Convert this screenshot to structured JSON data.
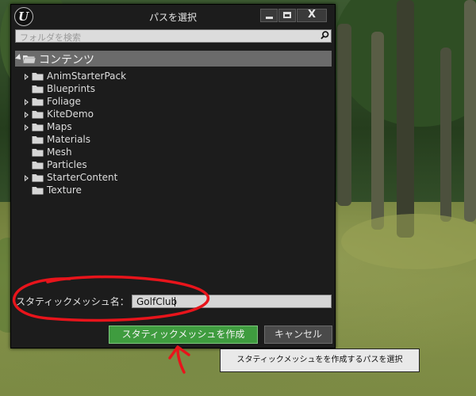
{
  "window": {
    "title": "パスを選択",
    "logo_text": "U",
    "minimize_label": "",
    "close_label": "X"
  },
  "search": {
    "placeholder": "フォルダを検索"
  },
  "tree": {
    "root_label": "コンテンツ",
    "items": [
      {
        "label": "AnimStarterPack",
        "expandable": true
      },
      {
        "label": "Blueprints",
        "expandable": false
      },
      {
        "label": "Foliage",
        "expandable": true
      },
      {
        "label": "KiteDemo",
        "expandable": true
      },
      {
        "label": "Maps",
        "expandable": true
      },
      {
        "label": "Materials",
        "expandable": false
      },
      {
        "label": "Mesh",
        "expandable": false
      },
      {
        "label": "Particles",
        "expandable": false
      },
      {
        "label": "StarterContent",
        "expandable": true
      },
      {
        "label": "Texture",
        "expandable": false
      }
    ]
  },
  "form": {
    "name_label": "スタティックメッシュ名：",
    "name_value": "GolfClub"
  },
  "buttons": {
    "create": "スタティックメッシュを作成",
    "cancel": "キャンセル"
  },
  "tooltip": {
    "text": "スタティックメッシュをを作成するパスを選択"
  },
  "colors": {
    "accent_green": "#3f9c3f",
    "annotation_red": "#e8141b",
    "dialog_bg": "#1c1c1c"
  }
}
